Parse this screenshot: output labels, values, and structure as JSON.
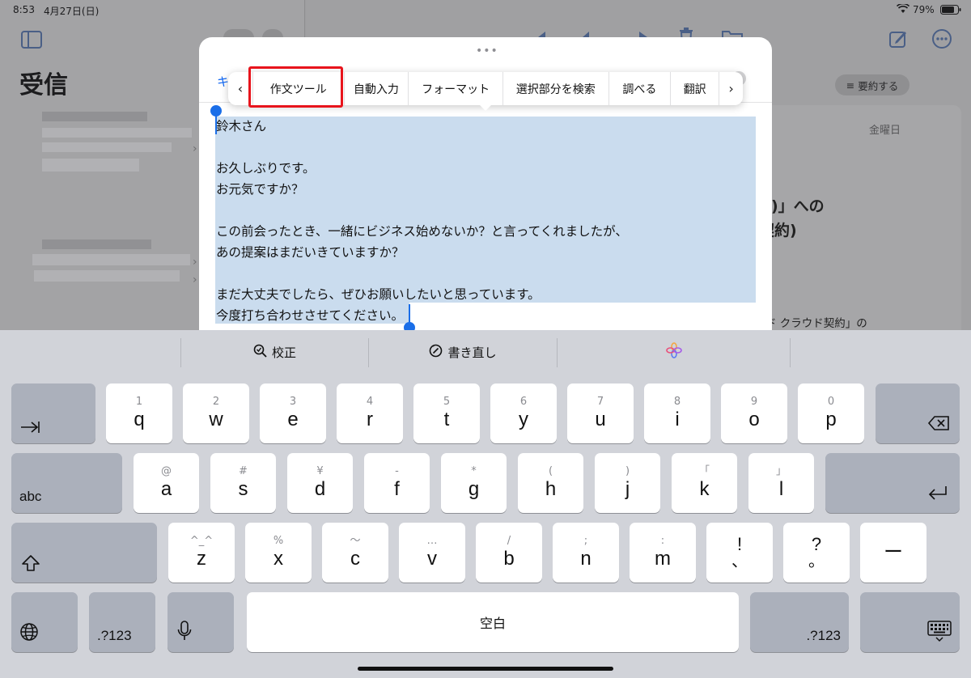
{
  "status_bar": {
    "time": "8:53",
    "date": "4月27日(日)",
    "battery": "79%"
  },
  "mail": {
    "mailbox_title": "受信",
    "summarize_label": "要約する",
    "day_label": "金曜日",
    "subject_line_1": "様)」への",
    "subject_line_2": "契約)",
    "snippet": "ド クラウド契約」の"
  },
  "compose": {
    "grabber": "•••",
    "cancel_partial": "キ",
    "body_lines": [
      "鈴木さん",
      "",
      "お久しぶりです。",
      "お元気ですか？",
      "",
      "この前会ったとき、一緒にビジネス始めないか？と言ってくれましたが、",
      "あの提案はまだいきていますか？",
      "",
      "まだ大丈夫でしたら、ぜひお願いしたいと思っています。",
      "今度打ち合わせさせてください。"
    ]
  },
  "edit_menu": {
    "prev": "‹",
    "next": "›",
    "items": [
      "作文ツール",
      "自動入力",
      "フォーマット",
      "選択部分を検索",
      "調べる",
      "翻訳"
    ]
  },
  "suggestions": {
    "proofread": "校正",
    "rewrite": "書き直し"
  },
  "keyboard": {
    "row1": [
      {
        "hint": "1",
        "label": "q"
      },
      {
        "hint": "2",
        "label": "w"
      },
      {
        "hint": "3",
        "label": "e"
      },
      {
        "hint": "4",
        "label": "r"
      },
      {
        "hint": "5",
        "label": "t"
      },
      {
        "hint": "6",
        "label": "y"
      },
      {
        "hint": "7",
        "label": "u"
      },
      {
        "hint": "8",
        "label": "i"
      },
      {
        "hint": "9",
        "label": "o"
      },
      {
        "hint": "0",
        "label": "p"
      }
    ],
    "row2": [
      {
        "hint": "@",
        "label": "a"
      },
      {
        "hint": "#",
        "label": "s"
      },
      {
        "hint": "¥",
        "label": "d"
      },
      {
        "hint": "-",
        "label": "f"
      },
      {
        "hint": "*",
        "label": "g"
      },
      {
        "hint": "(",
        "label": "h"
      },
      {
        "hint": ")",
        "label": "j"
      },
      {
        "hint": "「",
        "label": "k"
      },
      {
        "hint": "」",
        "label": "l"
      }
    ],
    "row3": [
      {
        "hint": "^_^",
        "label": "z"
      },
      {
        "hint": "%",
        "label": "x"
      },
      {
        "hint": "〜",
        "label": "c"
      },
      {
        "hint": "…",
        "label": "v"
      },
      {
        "hint": "/",
        "label": "b"
      },
      {
        "hint": ";",
        "label": "n"
      },
      {
        "hint": ":",
        "label": "m"
      },
      {
        "hint": "!",
        "label": "、"
      },
      {
        "hint": "?",
        "label": "。"
      }
    ],
    "dash": "ー",
    "abc": "abc",
    "numbers_left": ".?123",
    "numbers_right": ".?123",
    "space": "空白"
  }
}
